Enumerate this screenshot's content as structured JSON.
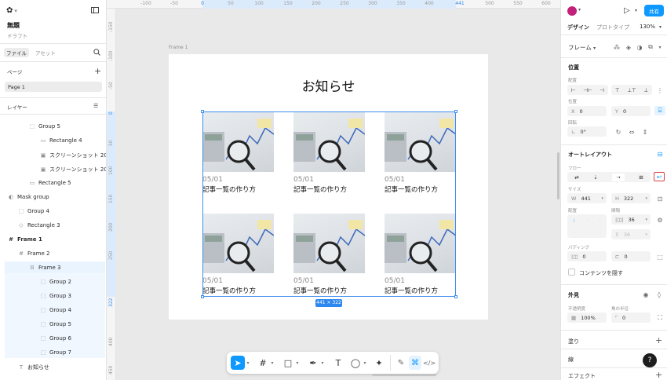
{
  "left": {
    "file_name": "無題",
    "file_status": "ドラフト",
    "tabs": [
      "ファイル",
      "アセット"
    ],
    "pages_heading": "ページ",
    "page_item": "Page 1",
    "layers_heading": "レイヤー",
    "layers": [
      "Group 5",
      "Rectangle 4",
      "スクリーンショット 2025",
      "スクリーンショット 2025",
      "Rectangle 5",
      "Mask group",
      "Group 4",
      "Rectangle 3",
      "Frame 1",
      "Frame 2",
      "Frame 3",
      "Group 2",
      "Group 3",
      "Group 4",
      "Group 5",
      "Group 6",
      "Group 7",
      "お知らせ"
    ]
  },
  "ruler": {
    "top": [
      "-100",
      "-50",
      "0",
      "50",
      "100",
      "150",
      "200",
      "250",
      "300",
      "350",
      "400",
      "441",
      "500",
      "550",
      "600"
    ],
    "left": [
      "-150",
      "-100",
      "-50",
      "0",
      "50",
      "100",
      "150",
      "200",
      "250",
      "322",
      "400",
      "450"
    ]
  },
  "canvas": {
    "frame_label": "Frame 1",
    "heading": "お知らせ",
    "cards": [
      {
        "date": "05/01",
        "title": "記事一覧の作り方"
      },
      {
        "date": "05/01",
        "title": "記事一覧の作り方"
      },
      {
        "date": "05/01",
        "title": "記事一覧の作り方"
      },
      {
        "date": "05/01",
        "title": "記事一覧の作り方"
      },
      {
        "date": "05/01",
        "title": "記事一覧の作り方"
      },
      {
        "date": "05/01",
        "title": "記事一覧の作り方"
      }
    ],
    "size_badge": "441 × 322"
  },
  "right": {
    "share": "共有",
    "tabs": [
      "デザイン",
      "プロトタイプ"
    ],
    "zoom": "130%",
    "frame_label": "フレーム",
    "position_heading": "位置",
    "align_label": "配置",
    "position_label": "位置",
    "x_label": "X",
    "x_value": "0",
    "y_label": "Y",
    "y_value": "0",
    "rotation_label": "回転",
    "rotation_value": "0°",
    "autolayout_heading": "オートレイアウト",
    "flow_label": "フロー",
    "size_label": "サイズ",
    "w_label": "W",
    "w_value": "441",
    "h_label": "H",
    "h_value": "322",
    "align2_label": "配置",
    "gap_label": "間隔",
    "gap_value": "36",
    "gap2_value": "36",
    "padding_label": "パディング",
    "pad_h": "0",
    "pad_v": "0",
    "clip_label": "コンテンツを隠す",
    "appearance_heading": "外見",
    "opacity_label": "不透明度",
    "radius_label": "角の半径",
    "opacity_value": "100%",
    "radius_value": "0",
    "fill_heading": "塗り",
    "stroke_heading": "線",
    "effects_heading": "エフェクト",
    "help": "?"
  },
  "colors": {
    "accent": "#0d99ff",
    "selection": "#3d8ef0",
    "highlight": "#eaf4ff"
  }
}
